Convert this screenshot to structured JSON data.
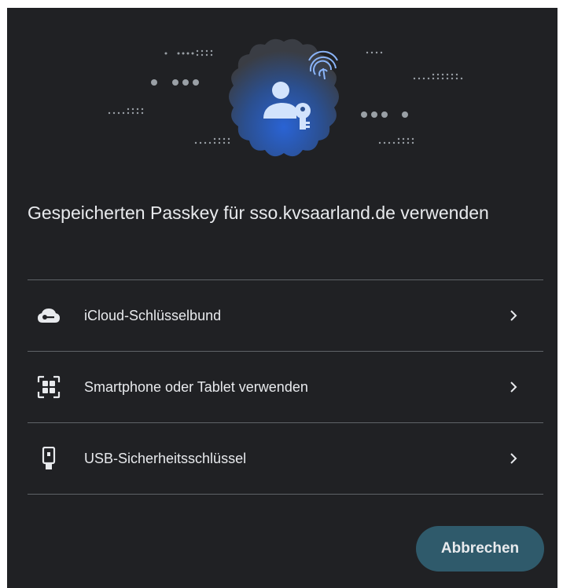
{
  "dialog": {
    "title": "Gespeicherten Passkey für sso.kvsaarland.de verwenden",
    "options": [
      {
        "label": "iCloud-Schlüsselbund",
        "icon": "icloud-key-icon"
      },
      {
        "label": "Smartphone oder Tablet verwenden",
        "icon": "qr-code-icon"
      },
      {
        "label": "USB-Sicherheitsschlüssel",
        "icon": "usb-key-icon"
      }
    ],
    "cancel_label": "Abbrechen"
  },
  "colors": {
    "background": "#202124",
    "text": "#e8eaed",
    "accent_button": "#2f5a6b",
    "badge_blue": "#8ab4f8",
    "divider": "#5f6368"
  }
}
